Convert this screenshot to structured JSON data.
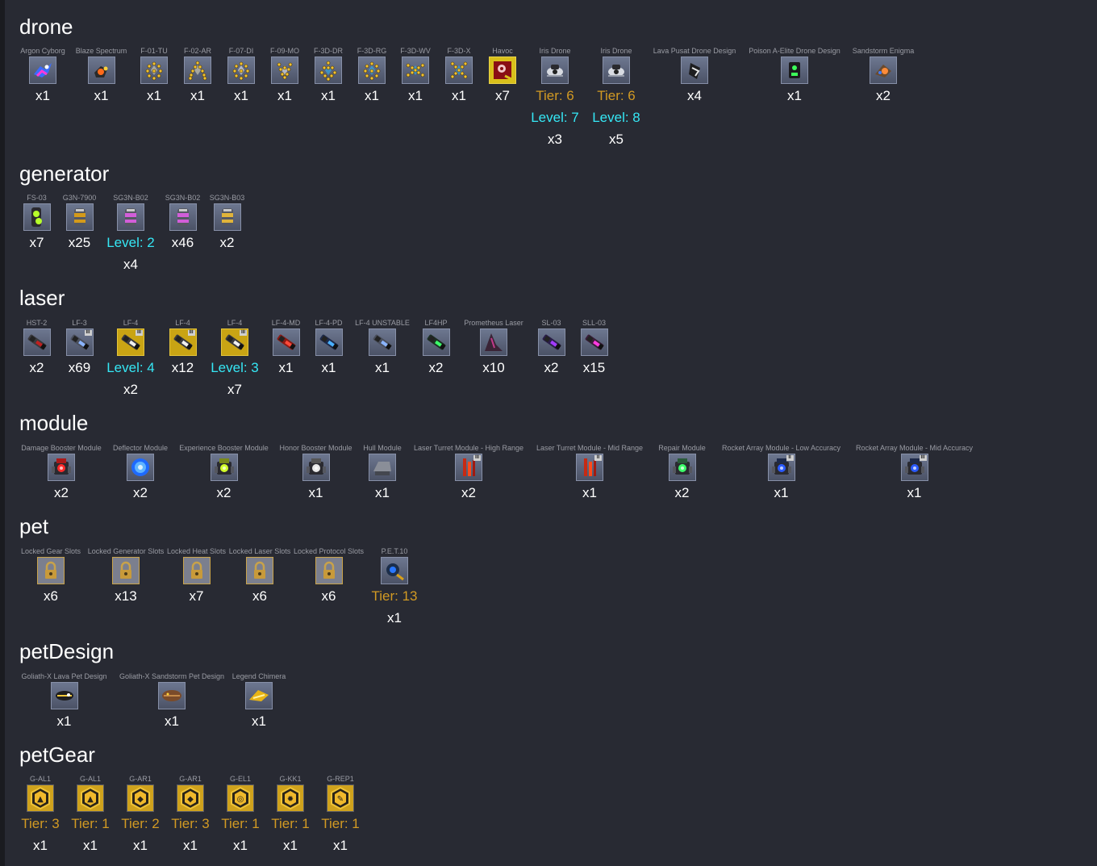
{
  "colors": {
    "background": "#282a33",
    "tier": "#d29a23",
    "level": "#35e7f5",
    "quantity": "#ffffff",
    "item_name": "#9a9ca4"
  },
  "sections": [
    {
      "title": "drone",
      "items": [
        {
          "name": "Argon Cyborg",
          "icon": "argon-cyborg-icon",
          "quantity": "x1"
        },
        {
          "name": "Blaze Spectrum",
          "icon": "blaze-spectrum-icon",
          "quantity": "x1"
        },
        {
          "name": "F-01-TU",
          "icon": "drone-formation-icon",
          "quantity": "x1"
        },
        {
          "name": "F-02-AR",
          "icon": "drone-formation-icon",
          "quantity": "x1"
        },
        {
          "name": "F-07-DI",
          "icon": "drone-formation-icon",
          "quantity": "x1"
        },
        {
          "name": "F-09-MO",
          "icon": "drone-formation-icon",
          "quantity": "x1"
        },
        {
          "name": "F-3D-DR",
          "icon": "drone-formation-icon",
          "quantity": "x1"
        },
        {
          "name": "F-3D-RG",
          "icon": "drone-formation-icon",
          "quantity": "x1"
        },
        {
          "name": "F-3D-WV",
          "icon": "drone-formation-icon",
          "quantity": "x1"
        },
        {
          "name": "F-3D-X",
          "icon": "drone-formation-icon",
          "quantity": "x1"
        },
        {
          "name": "Havoc",
          "icon": "havoc-design-icon",
          "quantity": "x7"
        },
        {
          "name": "Iris Drone",
          "icon": "iris-drone-icon",
          "tier": "Tier: 6",
          "level": "Level: 7",
          "quantity": "x3"
        },
        {
          "name": "Iris Drone",
          "icon": "iris-drone-icon",
          "tier": "Tier: 6",
          "level": "Level: 8",
          "quantity": "x5"
        },
        {
          "name": "Lava Pusat Drone Design",
          "icon": "lava-drone-design-icon",
          "quantity": "x4"
        },
        {
          "name": "Poison A-Elite Drone Design",
          "icon": "poison-drone-design-icon",
          "quantity": "x1"
        },
        {
          "name": "Sandstorm Enigma",
          "icon": "sandstorm-enigma-icon",
          "quantity": "x2"
        }
      ]
    },
    {
      "title": "generator",
      "items": [
        {
          "name": "FS-03",
          "icon": "fs03-generator-icon",
          "quantity": "x7"
        },
        {
          "name": "G3N-7900",
          "icon": "g3n-generator-icon",
          "quantity": "x25"
        },
        {
          "name": "SG3N-B02",
          "icon": "shield-generator-icon",
          "level": "Level: 2",
          "quantity": "x4"
        },
        {
          "name": "SG3N-B02",
          "icon": "shield-generator-icon",
          "quantity": "x46"
        },
        {
          "name": "SG3N-B03",
          "icon": "shield-generator-gold-icon",
          "quantity": "x2"
        }
      ]
    },
    {
      "title": "laser",
      "items": [
        {
          "name": "HST-2",
          "icon": "hellstorm-launcher-icon",
          "quantity": "x2"
        },
        {
          "name": "LF-3",
          "icon": "laser-cannon-icon",
          "quantity": "x69"
        },
        {
          "name": "LF-4",
          "icon": "lf4-laser-icon",
          "level": "Level: 4",
          "quantity": "x2"
        },
        {
          "name": "LF-4",
          "icon": "lf4-laser-icon",
          "quantity": "x12"
        },
        {
          "name": "LF-4",
          "icon": "lf4-laser-icon",
          "level": "Level: 3",
          "quantity": "x7"
        },
        {
          "name": "LF-4-MD",
          "icon": "laser-cannon-red-icon",
          "quantity": "x1"
        },
        {
          "name": "LF-4-PD",
          "icon": "laser-cannon-blue-icon",
          "quantity": "x1"
        },
        {
          "name": "LF-4 UNSTABLE",
          "icon": "laser-cannon-icon",
          "quantity": "x1"
        },
        {
          "name": "LF4HP",
          "icon": "laser-cannon-green-icon",
          "quantity": "x2"
        },
        {
          "name": "Prometheus Laser",
          "icon": "prometheus-laser-icon",
          "quantity": "x10"
        },
        {
          "name": "SL-03",
          "icon": "laser-cannon-purple-icon",
          "quantity": "x2"
        },
        {
          "name": "SLL-03",
          "icon": "laser-cannon-magenta-icon",
          "quantity": "x15"
        }
      ]
    },
    {
      "title": "module",
      "items": [
        {
          "name": "Damage Booster Module",
          "icon": "damage-booster-module-icon",
          "quantity": "x2"
        },
        {
          "name": "Deflector Module",
          "icon": "deflector-module-icon",
          "quantity": "x2"
        },
        {
          "name": "Experience Booster Module",
          "icon": "experience-booster-module-icon",
          "quantity": "x2"
        },
        {
          "name": "Honor Booster Module",
          "icon": "honor-booster-module-icon",
          "quantity": "x1"
        },
        {
          "name": "Hull Module",
          "icon": "hull-module-icon",
          "quantity": "x1"
        },
        {
          "name": "Laser Turret Module - High Range",
          "icon": "laser-turret-module-icon",
          "quantity": "x2"
        },
        {
          "name": "Laser Turret Module - Mid Range",
          "icon": "laser-turret-module-icon",
          "quantity": "x1"
        },
        {
          "name": "Repair Module",
          "icon": "repair-module-icon",
          "quantity": "x2"
        },
        {
          "name": "Rocket Array Module - Low Accuracy",
          "icon": "rocket-array-module-icon",
          "quantity": "x1"
        },
        {
          "name": "Rocket Array Module - Mid Accuracy",
          "icon": "rocket-array-module-icon",
          "quantity": "x1"
        }
      ]
    },
    {
      "title": "pet",
      "items": [
        {
          "name": "Locked Gear Slots",
          "icon": "lock-icon",
          "quantity": "x6"
        },
        {
          "name": "Locked Generator Slots",
          "icon": "lock-icon",
          "quantity": "x13"
        },
        {
          "name": "Locked Heat Slots",
          "icon": "lock-icon",
          "quantity": "x7"
        },
        {
          "name": "Locked Laser Slots",
          "icon": "lock-icon",
          "quantity": "x6"
        },
        {
          "name": "Locked Protocol Slots",
          "icon": "lock-icon",
          "quantity": "x6"
        },
        {
          "name": "P.E.T.10",
          "icon": "pet-icon",
          "tier": "Tier: 13",
          "quantity": "x1"
        }
      ]
    },
    {
      "title": "petDesign",
      "items": [
        {
          "name": "Goliath-X Lava Pet Design",
          "icon": "lava-pet-design-icon",
          "quantity": "x1"
        },
        {
          "name": "Goliath-X Sandstorm Pet Design",
          "icon": "sandstorm-pet-design-icon",
          "quantity": "x1"
        },
        {
          "name": "Legend Chimera",
          "icon": "chimera-pet-design-icon",
          "quantity": "x1"
        }
      ]
    },
    {
      "title": "petGear",
      "items": [
        {
          "name": "G-AL1",
          "icon": "auto-looter-icon",
          "tier": "Tier: 3",
          "quantity": "x1"
        },
        {
          "name": "G-AL1",
          "icon": "auto-looter-icon",
          "tier": "Tier: 1",
          "quantity": "x1"
        },
        {
          "name": "G-AR1",
          "icon": "auto-resource-icon",
          "tier": "Tier: 2",
          "quantity": "x1"
        },
        {
          "name": "G-AR1",
          "icon": "auto-resource-icon",
          "tier": "Tier: 3",
          "quantity": "x1"
        },
        {
          "name": "G-EL1",
          "icon": "enemy-locator-icon",
          "tier": "Tier: 1",
          "quantity": "x1"
        },
        {
          "name": "G-KK1",
          "icon": "kamikaze-icon",
          "tier": "Tier: 1",
          "quantity": "x1"
        },
        {
          "name": "G-REP1",
          "icon": "repair-wrench-icon",
          "tier": "Tier: 1",
          "quantity": "x1"
        }
      ]
    }
  ]
}
